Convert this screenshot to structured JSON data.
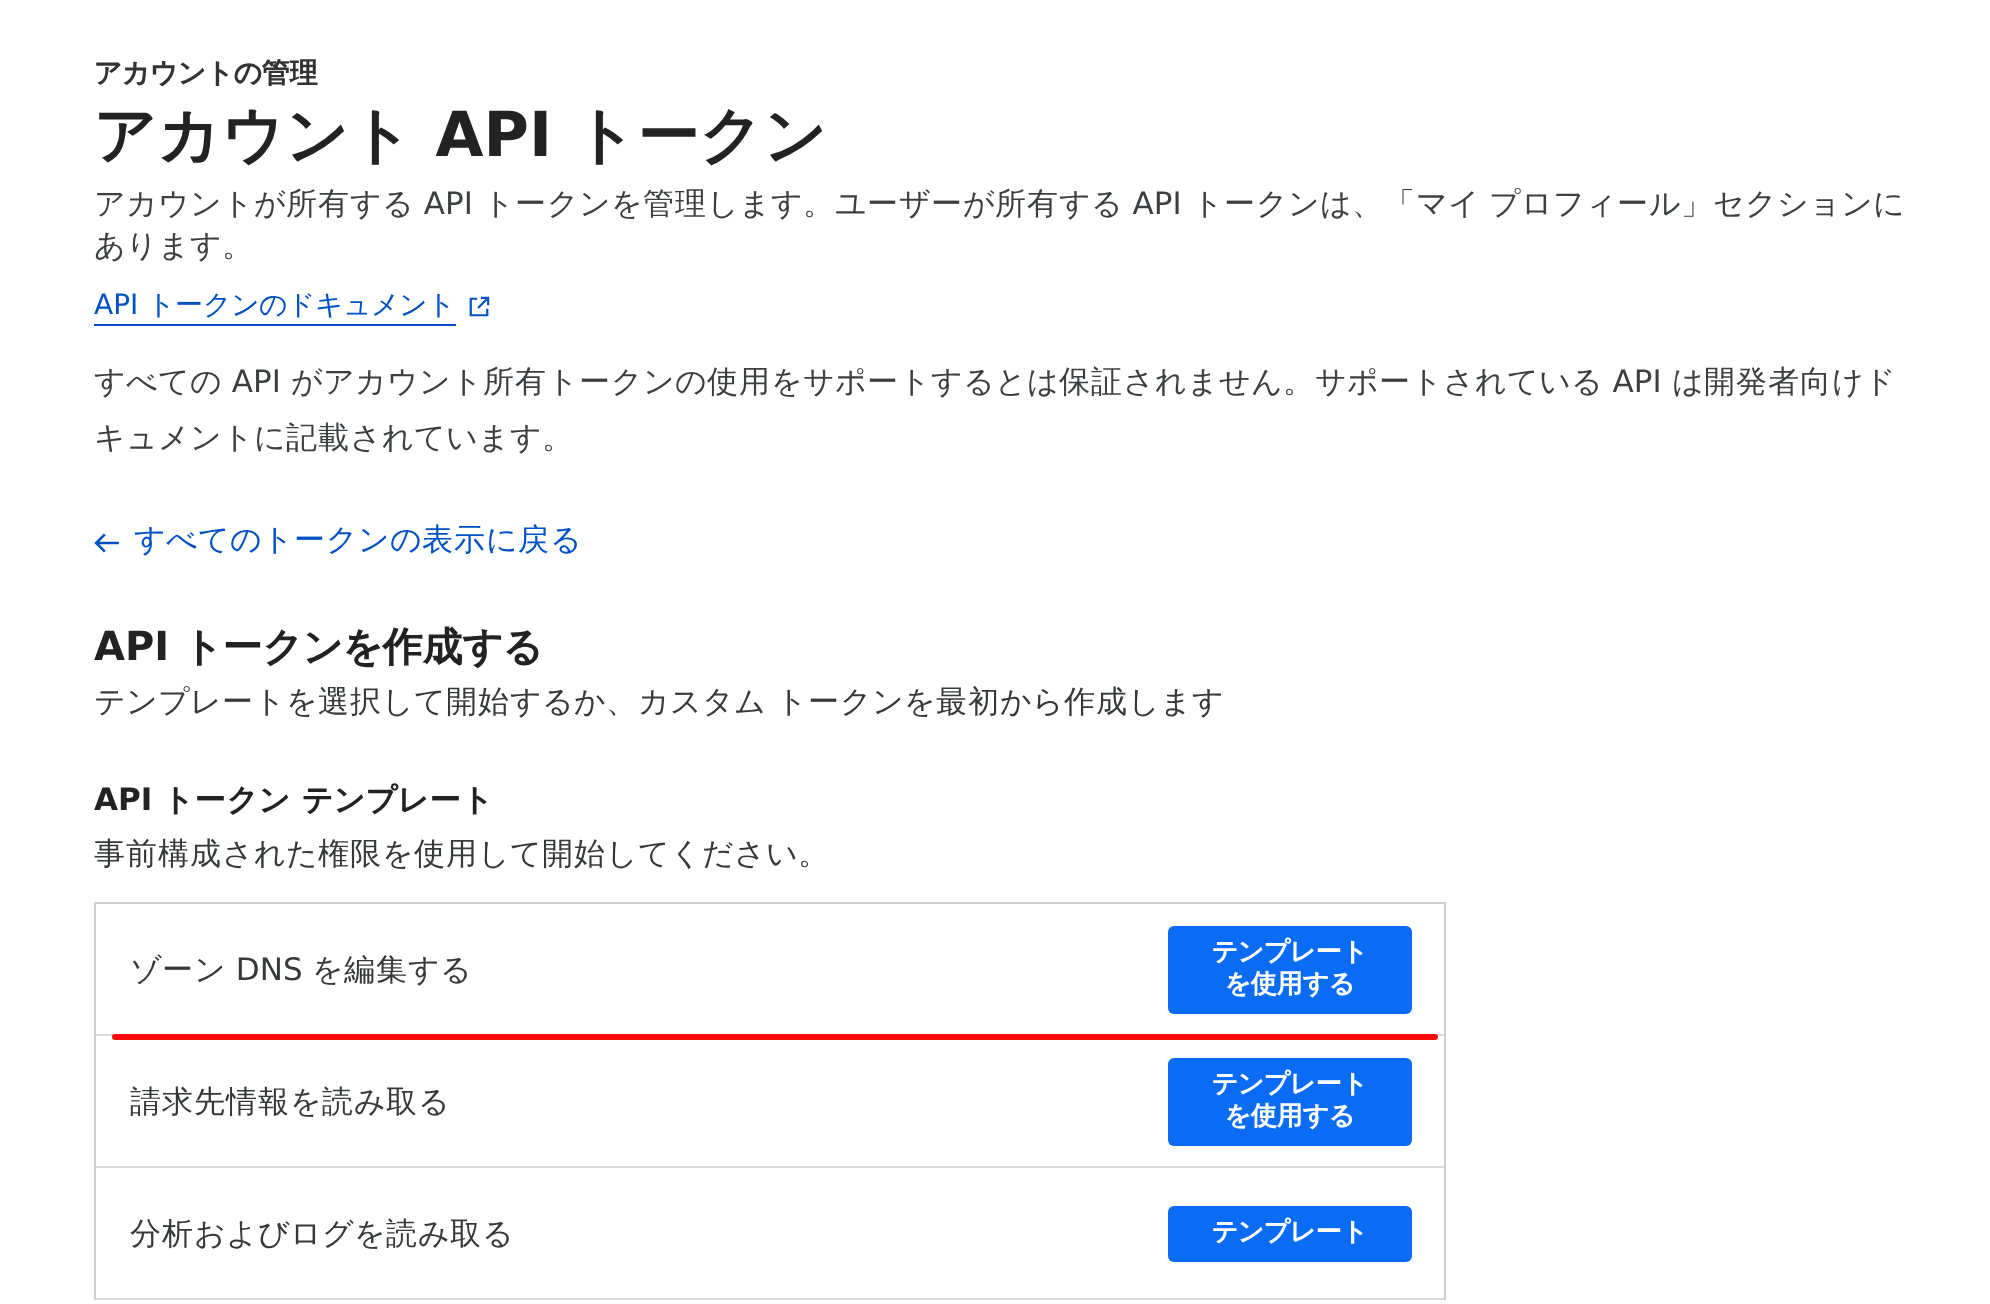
{
  "breadcrumb": "アカウントの管理",
  "title": "アカウント API トークン",
  "description": "アカウントが所有する API トークンを管理します。ユーザーが所有する API トークンは、「マイ プロフィール」セクションにあります。",
  "docs_link": {
    "label": "API トークンのドキュメント"
  },
  "notice": "すべての API がアカウント所有トークンの使用をサポートするとは保証されません。サポートされている API は開発者向けドキュメントに記載されています。",
  "back_link": {
    "label": "すべてのトークンの表示に戻る"
  },
  "create_section": {
    "heading": "API トークンを作成する",
    "subtitle": "テンプレートを選択して開始するか、カスタム トークンを最初から作成します"
  },
  "templates": {
    "heading": "API トークン テンプレート",
    "subtitle": "事前構成された権限を使用して開始してください。",
    "rows": [
      {
        "name": "ゾーン DNS を編集する",
        "button": "テンプレートを使用する",
        "highlighted": true
      },
      {
        "name": "請求先情報を読み取る",
        "button": "テンプレートを使用する",
        "highlighted": false
      },
      {
        "name": "分析およびログを読み取る",
        "button": "テンプレート",
        "highlighted": false
      }
    ]
  }
}
